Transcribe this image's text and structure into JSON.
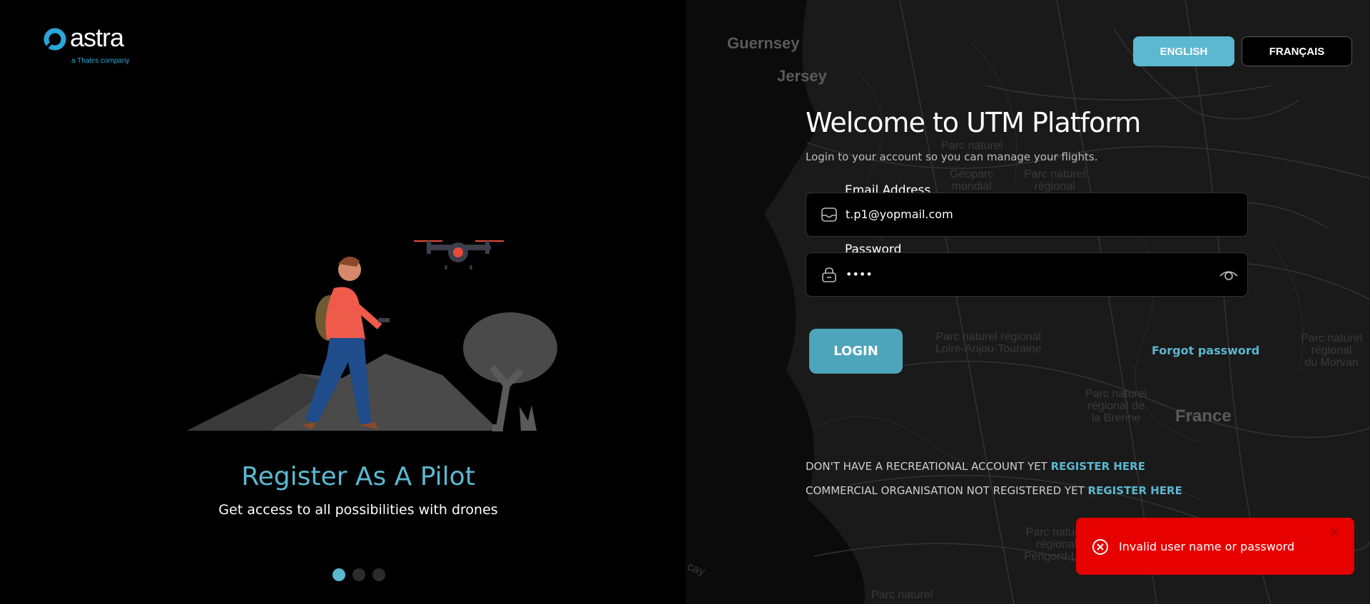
{
  "brand": {
    "name": "astra",
    "tagline": "a Thales company",
    "accent": "#5bb8cf"
  },
  "slide": {
    "title": "Register As A Pilot",
    "subtitle": "Get access to all possibilities with drones",
    "dots_total": 3,
    "dots_active": 1
  },
  "language": {
    "english": "ENGLISH",
    "french": "FRANÇAIS",
    "selected": "ENGLISH"
  },
  "login": {
    "title": "Welcome to UTM Platform",
    "subtitle": "Login to your account so you can manage your flights.",
    "email_label": "Email Address",
    "email_value": "t.p1@yopmail.com",
    "password_label": "Password",
    "password_value": "••••",
    "login_button": "LOGIN",
    "forgot_password": "Forgot password"
  },
  "register": {
    "recreational_text": "DON'T HAVE A RECREATIONAL ACCOUNT YET",
    "recreational_link": "REGISTER HERE",
    "commercial_text": "COMMERCIAL ORGANISATION NOT REGISTERED YET",
    "commercial_link": "REGISTER HERE"
  },
  "toast": {
    "message": "Invalid user name or password",
    "close": "✕",
    "color": "#e60000"
  },
  "map_labels": {
    "guernsey": "Guernsey",
    "jersey": "Jersey",
    "france": "France",
    "pnr1": "Parc naturel",
    "geoparc": "Géoparc\nmondial",
    "pnr2": "Parc naturel\nrégional",
    "loire": "Parc naturel régional\nLoire-Anjou-Touraine",
    "brenne": "Parc naturel\nrégional de\nla Brenne",
    "morvan": "Parc naturel\nrégional\ndu Morvan",
    "perigord": "Parc naturel\nrégional\nPérigord-Lim",
    "pnr_bottom": "Parc naturel",
    "cay": "cay"
  }
}
